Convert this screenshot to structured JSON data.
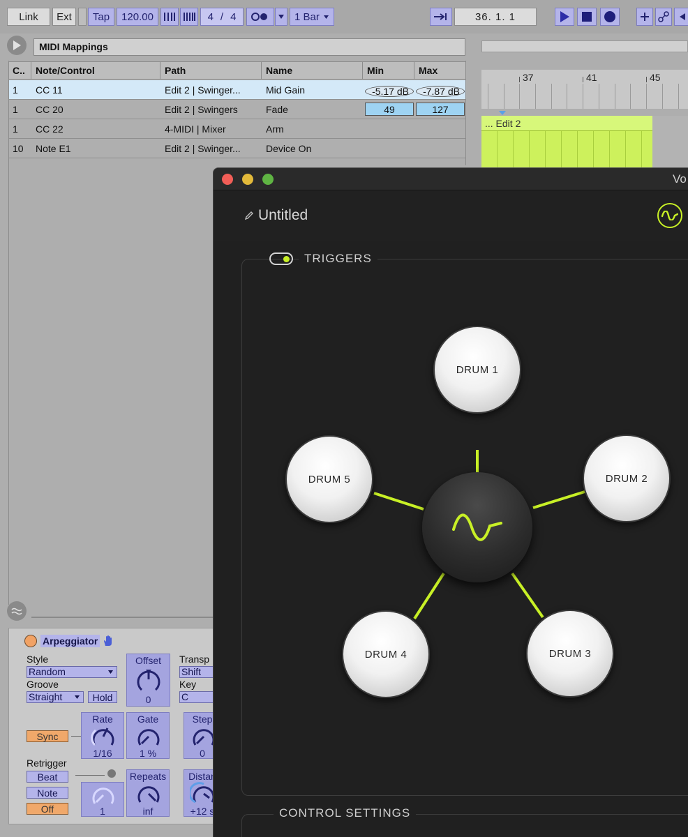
{
  "toolbar": {
    "link": "Link",
    "ext": "Ext",
    "tap": "Tap",
    "tempo": "120.00",
    "sig_num": "4",
    "sig_sep": "/",
    "sig_den": "4",
    "quant": "1 Bar",
    "position": "36.  1.  1"
  },
  "midi_mappings": {
    "title": "MIDI Mappings",
    "columns": [
      "C..",
      "Note/Control",
      "Path",
      "Name",
      "Min",
      "Max"
    ],
    "rows": [
      {
        "ch": "1",
        "control": "CC 11",
        "path": "Edit 2 | Swinger...",
        "name": "Mid Gain",
        "min": "-5.17 dB",
        "max": "-7.87 dB"
      },
      {
        "ch": "1",
        "control": "CC 20",
        "path": "Edit 2 | Swingers",
        "name": "Fade",
        "min": "49",
        "max": "127"
      },
      {
        "ch": "1",
        "control": "CC 22",
        "path": "4-MIDI | Mixer",
        "name": "Arm",
        "min": "",
        "max": ""
      },
      {
        "ch": "10",
        "control": "Note E1",
        "path": "Edit 2 | Swinger...",
        "name": "Device On",
        "min": "",
        "max": ""
      }
    ]
  },
  "arrangement": {
    "ruler": [
      "37",
      "41",
      "45"
    ],
    "clip_name": "... Edit 2",
    "clip_color": "#cdf15c"
  },
  "arpeggiator": {
    "title": "Arpeggiator",
    "style_label": "Style",
    "style_value": "Random",
    "groove_label": "Groove",
    "groove_value": "Straight",
    "hold": "Hold",
    "offset_label": "Offset",
    "offset_value": "0",
    "transp_label": "Transp",
    "transp_value": "Shift",
    "key_label": "Key",
    "key_value": "C",
    "sync": "Sync",
    "rate_label": "Rate",
    "rate_value": "1/16",
    "gate_label": "Gate",
    "gate_value": "1 %",
    "steps_label": "Step",
    "steps_value": "0",
    "retrigger_label": "Retrigger",
    "beat": "Beat",
    "note": "Note",
    "off": "Off",
    "retrig_value": "1",
    "repeats_label": "Repeats",
    "repeats_value": "inf",
    "distance_label": "Distan",
    "distance_value": "+12 s"
  },
  "plugin": {
    "window_title": "Vo",
    "doc_name": "Untitled",
    "section_triggers": "TRIGGERS",
    "section_control": "CONTROL SETTINGS",
    "accent": "#c8f026",
    "drums": [
      "DRUM 1",
      "DRUM 2",
      "DRUM 3",
      "DRUM 4",
      "DRUM 5"
    ]
  }
}
